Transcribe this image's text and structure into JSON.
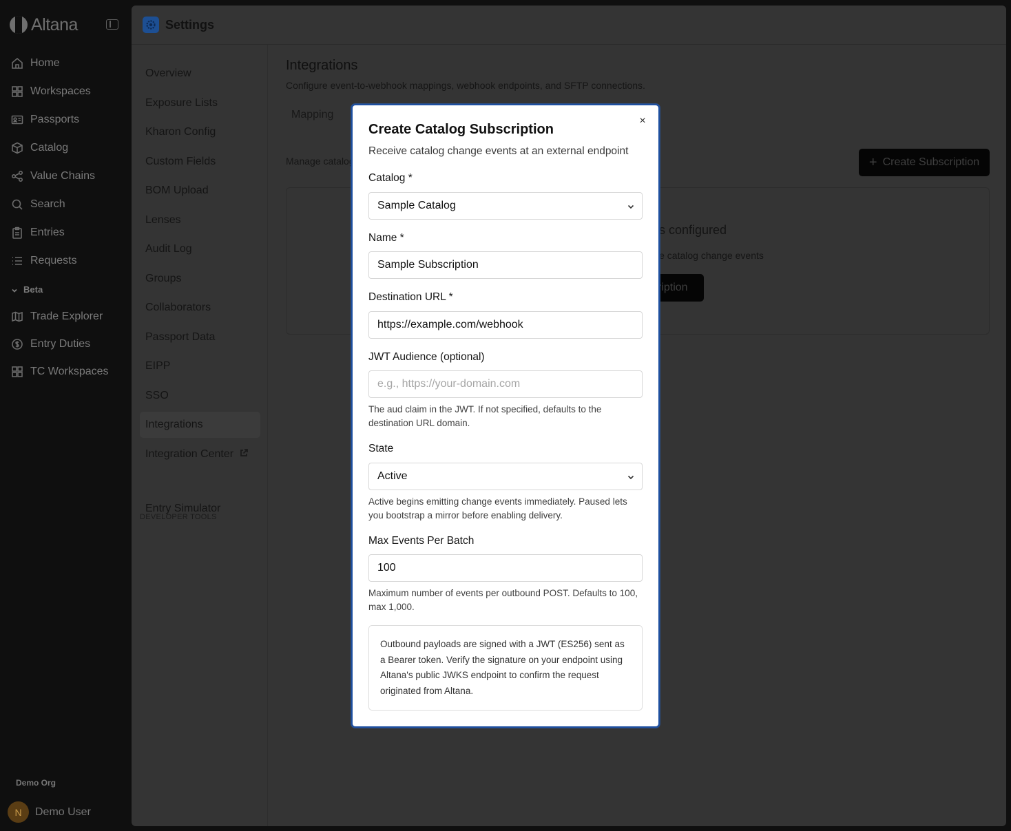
{
  "app": {
    "brand": "Altana",
    "nav": [
      {
        "label": "Home",
        "icon": "home-icon"
      },
      {
        "label": "Workspaces",
        "icon": "grid-icon"
      },
      {
        "label": "Passports",
        "icon": "id-card-icon"
      },
      {
        "label": "Catalog",
        "icon": "box-icon"
      },
      {
        "label": "Value Chains",
        "icon": "network-icon"
      },
      {
        "label": "Search",
        "icon": "search-icon"
      },
      {
        "label": "Entries",
        "icon": "clipboard-icon"
      },
      {
        "label": "Requests",
        "icon": "list-icon"
      }
    ],
    "beta_label": "Beta",
    "beta_nav": [
      {
        "label": "Trade Explorer",
        "icon": "map-icon"
      },
      {
        "label": "Entry Duties",
        "icon": "dollar-circle-icon"
      },
      {
        "label": "TC Workspaces",
        "icon": "grid-icon"
      }
    ],
    "org": "Demo Org",
    "user": {
      "initial": "N",
      "name": "Demo User"
    }
  },
  "settings": {
    "title": "Settings",
    "nav": [
      "Overview",
      "Exposure Lists",
      "Kharon Config",
      "Custom Fields",
      "BOM Upload",
      "Lenses",
      "Audit Log",
      "Groups",
      "Collaborators",
      "Passport Data",
      "EIPP",
      "SSO",
      "Integrations",
      "Integration Center"
    ],
    "active": "Integrations",
    "developer_section": "DEVELOPER TOOLS",
    "developer_nav": [
      "Entry Simulator"
    ]
  },
  "integrations": {
    "title": "Integrations",
    "subtitle": "Configure event-to-webhook mappings, webhook endpoints, and SFTP connections.",
    "tab": "Mapping",
    "manage_text": "Manage catalog",
    "create_button": "Create Subscription",
    "empty_title": "ns configured",
    "empty_sub": "ive catalog change events",
    "empty_button": "cription"
  },
  "modal": {
    "title": "Create Catalog Subscription",
    "subtitle": "Receive catalog change events at an external endpoint",
    "close_symbol": "×",
    "catalog_label": "Catalog *",
    "catalog_value": "Sample Catalog",
    "name_label": "Name *",
    "name_value": "Sample Subscription",
    "url_label": "Destination URL *",
    "url_value": "https://example.com/webhook",
    "jwt_label": "JWT Audience (optional)",
    "jwt_placeholder": "e.g., https://your-domain.com",
    "jwt_help": "The aud claim in the JWT. If not specified, defaults to the destination URL domain.",
    "state_label": "State",
    "state_value": "Active",
    "state_help": "Active begins emitting change events immediately. Paused lets you bootstrap a mirror before enabling delivery.",
    "max_label": "Max Events Per Batch",
    "max_value": "100",
    "max_help": "Maximum number of events per outbound POST. Defaults to 100, max 1,000.",
    "info": "Outbound payloads are signed with a JWT (ES256) sent as a Bearer token. Verify the signature on your endpoint using Altana's public JWKS endpoint to confirm the request originated from Altana."
  }
}
